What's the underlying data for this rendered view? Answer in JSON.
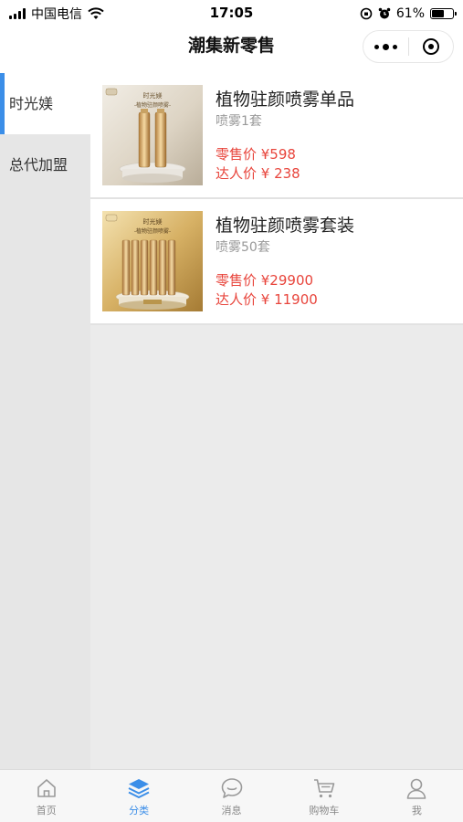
{
  "status_bar": {
    "carrier": "中国电信",
    "time": "17:05",
    "battery": "61%",
    "battery_level": 0.61
  },
  "nav": {
    "title": "潮集新零售"
  },
  "sidebar": {
    "items": [
      {
        "label": "时光媄",
        "active": true
      },
      {
        "label": "总代加盟",
        "active": false
      }
    ]
  },
  "products": [
    {
      "name": "植物驻颜喷雾单品",
      "spec": "喷雾1套",
      "retail_label": "零售价 ¥598",
      "kol_label": "达人价 ¥ 238",
      "image_brand": "时光媄",
      "image_subtitle": "-植物驻颜喷雾-"
    },
    {
      "name": "植物驻颜喷雾套装",
      "spec": "喷雾50套",
      "retail_label": "零售价 ¥29900",
      "kol_label": "达人价 ¥ 11900",
      "image_brand": "时光媄",
      "image_subtitle": "-植物驻颜喷雾-"
    }
  ],
  "tab_bar": {
    "tabs": [
      {
        "label": "首页",
        "icon": "home-icon",
        "active": false
      },
      {
        "label": "分类",
        "icon": "layers-icon",
        "active": true
      },
      {
        "label": "消息",
        "icon": "message-icon",
        "active": false
      },
      {
        "label": "购物车",
        "icon": "cart-icon",
        "active": false
      },
      {
        "label": "我",
        "icon": "user-icon",
        "active": false
      }
    ]
  },
  "colors": {
    "accent": "#3b8ee8",
    "price": "#e8453c"
  }
}
